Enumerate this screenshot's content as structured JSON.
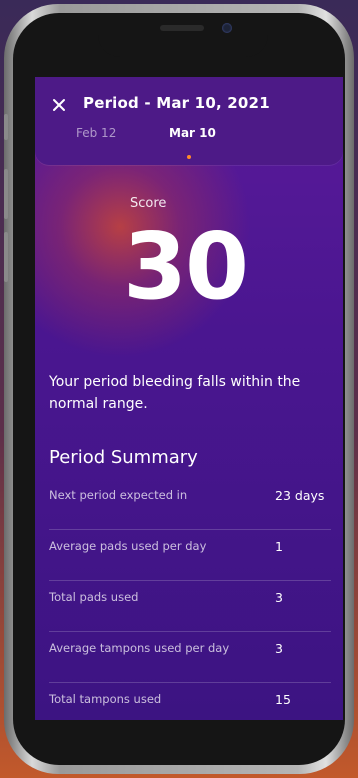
{
  "header": {
    "title": "Period - Mar 10, 2021",
    "tabs": [
      {
        "label": "Feb 12",
        "active": false
      },
      {
        "label": "Mar 10",
        "active": true
      }
    ]
  },
  "score": {
    "label": "Score",
    "value": "30"
  },
  "message": "Your period bleeding falls within the normal range.",
  "summary": {
    "title": "Period Summary",
    "rows": [
      {
        "label": "Next period expected in",
        "value": "23 days"
      },
      {
        "label": "Average pads used per day",
        "value": "1"
      },
      {
        "label": "Total pads used",
        "value": "3"
      },
      {
        "label": "Average tampons used per day",
        "value": "3"
      },
      {
        "label": "Total tampons used",
        "value": "15"
      }
    ]
  },
  "colors": {
    "background": "#4a1690",
    "header": "#4d1a87",
    "accent_dot": "#ff8a2a"
  },
  "icons": {
    "close": "close-icon"
  }
}
